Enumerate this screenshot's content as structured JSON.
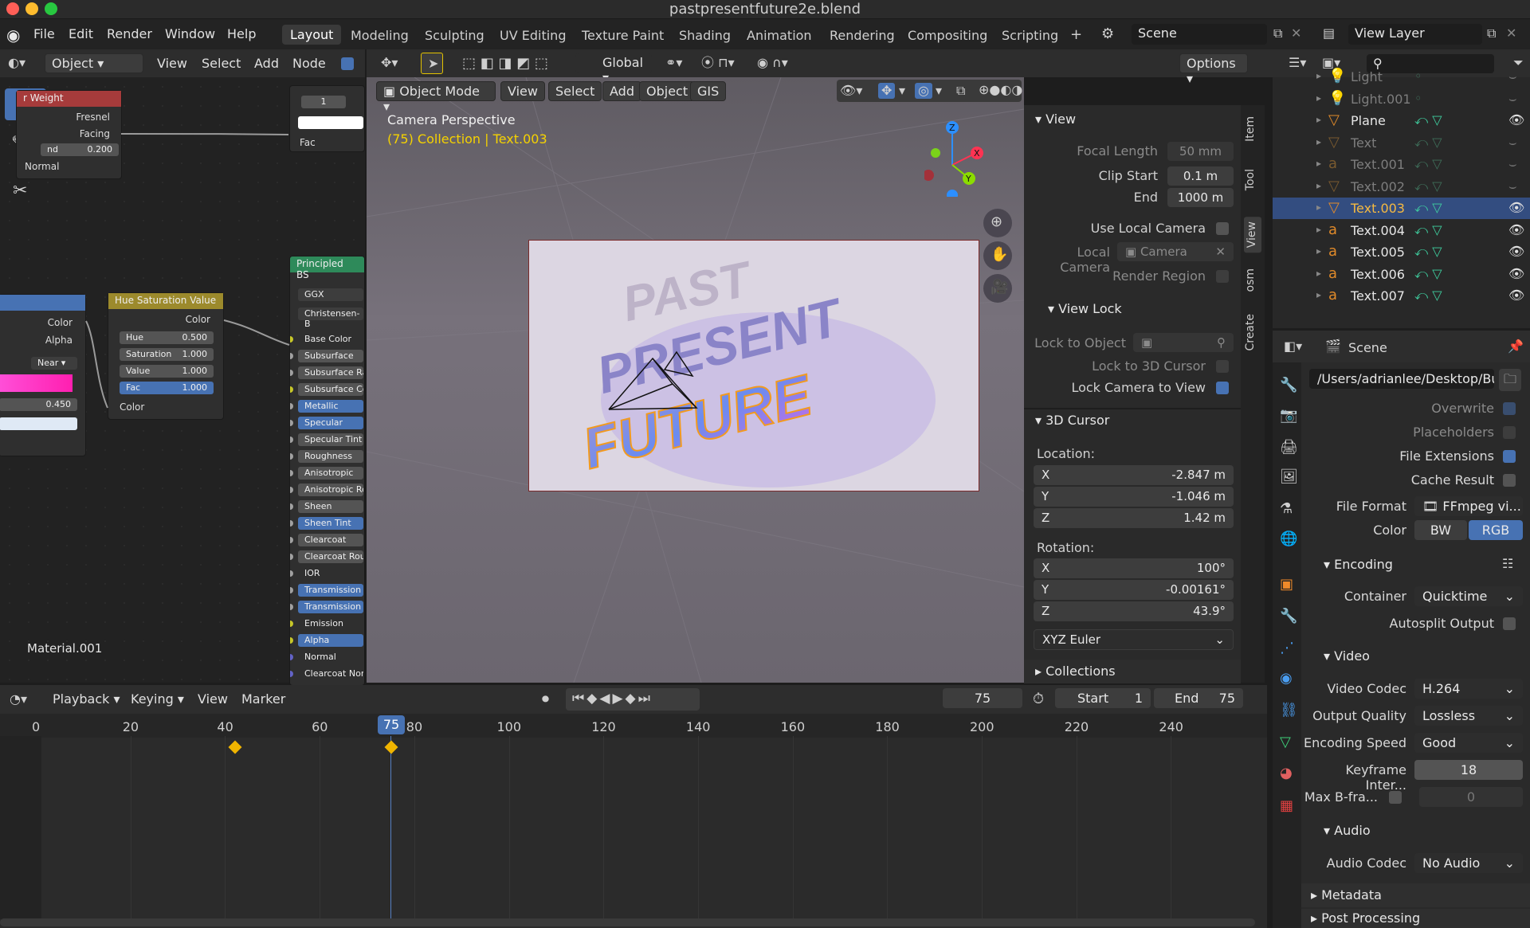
{
  "window": {
    "title": "pastpresentfuture2e.blend"
  },
  "menu": [
    "File",
    "Edit",
    "Render",
    "Window",
    "Help"
  ],
  "workspaces": [
    "Layout",
    "Modeling",
    "Sculpting",
    "UV Editing",
    "Texture Paint",
    "Shading",
    "Animation",
    "Rendering",
    "Compositing",
    "Scripting"
  ],
  "top_right": {
    "scene": "Scene",
    "view_layer": "View Layer"
  },
  "node_editor": {
    "header": {
      "mode": "Object",
      "view": "View",
      "select": "Select",
      "add": "Add",
      "node": "Node"
    },
    "layer_weight": {
      "title": "r Weight",
      "fresnel": "Fresnel",
      "facing": "Facing",
      "blend_label": "nd",
      "blend_value": "0.200",
      "normal": "Normal"
    },
    "value_node": {
      "value": "1",
      "fac": "Fac"
    },
    "hsv": {
      "title": "Hue Saturation Value",
      "color_out": "Color",
      "hue_label": "Hue",
      "hue": "0.500",
      "sat_label": "Saturation",
      "sat": "1.000",
      "val_label": "Value",
      "val": "1.000",
      "fac_label": "Fac",
      "fac": "1.000",
      "color_in": "Color"
    },
    "ramp": {
      "color": "Color",
      "alpha": "Alpha",
      "interp": "Near",
      "pos": "0.450"
    },
    "principled": {
      "title": "Principled BS",
      "dist": "GGX",
      "sss": "Christensen-B",
      "inputs": [
        "Base Color",
        "Subsurface",
        "Subsurface Ra",
        "Subsurface Col",
        "Metallic",
        "Specular",
        "Specular Tint",
        "Roughness",
        "Anisotropic",
        "Anisotropic Ro",
        "Sheen",
        "Sheen Tint",
        "Clearcoat",
        "Clearcoat Rou",
        "IOR",
        "Transmission",
        "Transmission",
        "Emission",
        "Alpha",
        "Normal",
        "Clearcoat Nor"
      ]
    },
    "material": "Material.001"
  },
  "viewport": {
    "toolbar": {
      "orientation": "Global",
      "options": "Options"
    },
    "header": {
      "mode": "Object Mode",
      "view": "View",
      "select": "Select",
      "add": "Add",
      "object": "Object",
      "gis": "GIS"
    },
    "overlay_text_1": "Camera Perspective",
    "overlay_text_2": "(75) Collection | Text.003",
    "gizmo": {
      "x": "X",
      "y": "Y",
      "z": "Z"
    }
  },
  "npanel": {
    "tabs": [
      "Item",
      "Tool",
      "View",
      "osm",
      "Create"
    ],
    "view_section": "View",
    "focal_length_label": "Focal Length",
    "focal_length": "50 mm",
    "clip_start_label": "Clip Start",
    "clip_start": "0.1 m",
    "end_label": "End",
    "end": "1000 m",
    "use_local_camera": "Use Local Camera",
    "local_camera_label": "Local Camera",
    "local_camera": "Camera",
    "render_region": "Render Region",
    "view_lock": "View Lock",
    "lock_to_object": "Lock to Object",
    "lock_3d_cursor": "Lock to 3D Cursor",
    "lock_camera": "Lock Camera to View",
    "cursor_section": "3D Cursor",
    "location": "Location:",
    "loc": [
      {
        "axis": "X",
        "value": "-2.847 m"
      },
      {
        "axis": "Y",
        "value": "-1.046 m"
      },
      {
        "axis": "Z",
        "value": "1.42 m"
      }
    ],
    "rotation": "Rotation:",
    "rot": [
      {
        "axis": "X",
        "value": "100°"
      },
      {
        "axis": "Y",
        "value": "-0.00161°"
      },
      {
        "axis": "Z",
        "value": "43.9°"
      }
    ],
    "rot_mode": "XYZ Euler",
    "collections": "Collections"
  },
  "outliner": {
    "items": [
      {
        "name": "Light",
        "dim": true
      },
      {
        "name": "Light.001",
        "dim": true
      },
      {
        "name": "Plane",
        "dim": false
      },
      {
        "name": "Text",
        "dim": true
      },
      {
        "name": "Text.001",
        "dim": true
      },
      {
        "name": "Text.002",
        "dim": true
      },
      {
        "name": "Text.003",
        "dim": false,
        "selected": true
      },
      {
        "name": "Text.004",
        "dim": false
      },
      {
        "name": "Text.005",
        "dim": false
      },
      {
        "name": "Text.006",
        "dim": false
      },
      {
        "name": "Text.007",
        "dim": false
      }
    ]
  },
  "properties": {
    "scene": "Scene",
    "path": "/Users/adrianlee/Desktop/Bu...",
    "overwrite": "Overwrite",
    "placeholders": "Placeholders",
    "file_extensions": "File Extensions",
    "cache_result": "Cache Result",
    "file_format_label": "File Format",
    "file_format": "FFmpeg vi...",
    "color_label": "Color",
    "bw": "BW",
    "rgb": "RGB",
    "encoding": "Encoding",
    "container_label": "Container",
    "container": "Quicktime",
    "autosplit": "Autosplit Output",
    "video": "Video",
    "codec_label": "Video Codec",
    "codec": "H.264",
    "quality_label": "Output Quality",
    "quality": "Lossless",
    "speed_label": "Encoding Speed",
    "speed": "Good",
    "keyframe_label": "Keyframe Inter...",
    "keyframe": "18",
    "bframes_label": "Max B-fra...",
    "bframes": "0",
    "audio": "Audio",
    "audio_codec_label": "Audio Codec",
    "audio_codec": "No Audio",
    "metadata": "Metadata",
    "post": "Post Processing"
  },
  "timeline": {
    "playback": "Playback",
    "keying": "Keying",
    "view": "View",
    "marker": "Marker",
    "current": "75",
    "start_label": "Start",
    "start": "1",
    "end_label": "End",
    "end": "75",
    "frames": [
      "0",
      "20",
      "40",
      "60",
      "80",
      "100",
      "120",
      "140",
      "160",
      "180",
      "200",
      "220",
      "240"
    ],
    "current_marker": "75"
  },
  "colors": {
    "accent": "#4772b3",
    "selected_row": "#334d80",
    "playhead": "#5680c2",
    "keyframe": "#f0b400"
  }
}
